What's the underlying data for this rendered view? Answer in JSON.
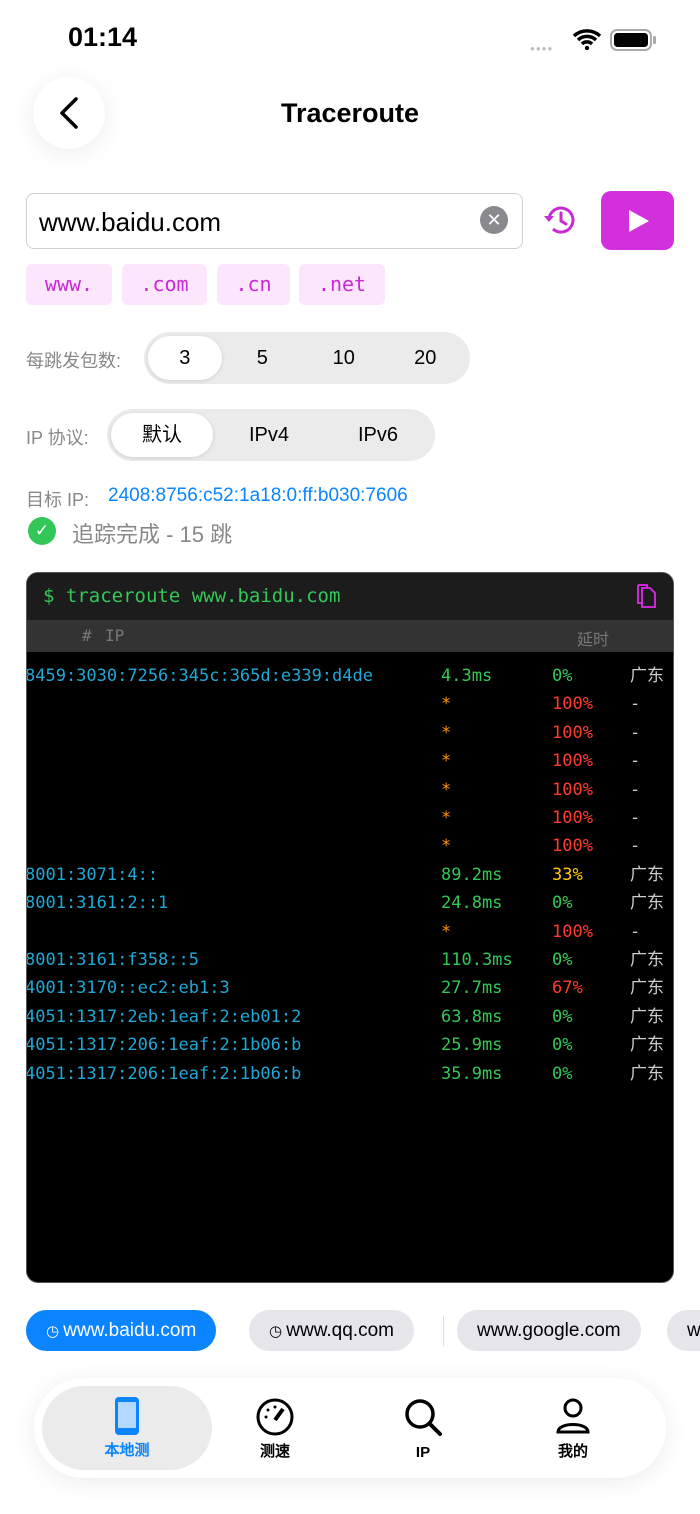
{
  "status": {
    "time": "01:14"
  },
  "header": {
    "title": "Traceroute"
  },
  "search": {
    "value": "www.baidu.com",
    "clear": "✕"
  },
  "suffix_chips": [
    "www.",
    ".com",
    ".cn",
    ".net"
  ],
  "packets": {
    "label": "每跳发包数:",
    "options": [
      "3",
      "5",
      "10",
      "20"
    ],
    "selected": "3"
  },
  "protocol": {
    "label": "IP 协议:",
    "options": [
      "默认",
      "IPv4",
      "IPv6"
    ],
    "selected": "默认"
  },
  "target": {
    "label": "目标 IP:",
    "ip": "2408:8756:c52:1a18:0:ff:b030:7606"
  },
  "result": {
    "text": "追踪完成 - 15 跳"
  },
  "terminal": {
    "command": "$ traceroute www.baidu.com",
    "col_hash": "#",
    "col_ip": "IP",
    "col_latency": "延时",
    "rows": [
      {
        "ip": "8459:3030:7256:345c:365d:e339:d4de",
        "latency": "4.3ms",
        "loss": "0%",
        "loc": "广东"
      },
      {
        "ip": "",
        "latency": "*",
        "loss": "100%",
        "loc": "-"
      },
      {
        "ip": "",
        "latency": "*",
        "loss": "100%",
        "loc": "-"
      },
      {
        "ip": "",
        "latency": "*",
        "loss": "100%",
        "loc": "-"
      },
      {
        "ip": "",
        "latency": "*",
        "loss": "100%",
        "loc": "-"
      },
      {
        "ip": "",
        "latency": "*",
        "loss": "100%",
        "loc": "-"
      },
      {
        "ip": "",
        "latency": "*",
        "loss": "100%",
        "loc": "-"
      },
      {
        "ip": "8001:3071:4::",
        "latency": "89.2ms",
        "loss": "33%",
        "loc": "广东"
      },
      {
        "ip": "8001:3161:2::1",
        "latency": "24.8ms",
        "loss": "0%",
        "loc": "广东"
      },
      {
        "ip": "",
        "latency": "*",
        "loss": "100%",
        "loc": "-"
      },
      {
        "ip": "8001:3161:f358::5",
        "latency": "110.3ms",
        "loss": "0%",
        "loc": "广东"
      },
      {
        "ip": "4001:3170::ec2:eb1:3",
        "latency": "27.7ms",
        "loss": "67%",
        "loc": "广东"
      },
      {
        "ip": "4051:1317:2eb:1eaf:2:eb01:2",
        "latency": "63.8ms",
        "loss": "0%",
        "loc": "广东"
      },
      {
        "ip": "4051:1317:206:1eaf:2:1b06:b",
        "latency": "25.9ms",
        "loss": "0%",
        "loc": "广东"
      },
      {
        "ip": "4051:1317:206:1eaf:2:1b06:b",
        "latency": "35.9ms",
        "loss": "0%",
        "loc": "广东"
      }
    ]
  },
  "history": [
    {
      "label": "www.baidu.com",
      "icon": "clock",
      "active": true
    },
    {
      "label": "www.qq.com",
      "icon": "clock",
      "active": false
    },
    {
      "label": "www.google.com",
      "active": false
    },
    {
      "label": "w",
      "active": false
    }
  ],
  "tabs": [
    {
      "label": "本地测",
      "active": true
    },
    {
      "label": "测速"
    },
    {
      "label": "IP"
    },
    {
      "label": "我的"
    }
  ],
  "colors": {
    "accent": "#d22fdd",
    "blue": "#0a84ff",
    "green": "#33c758",
    "red": "#ff3b30",
    "yellow": "#ffcc00",
    "orange": "#ff9500",
    "cyan": "#1fa8d6"
  }
}
